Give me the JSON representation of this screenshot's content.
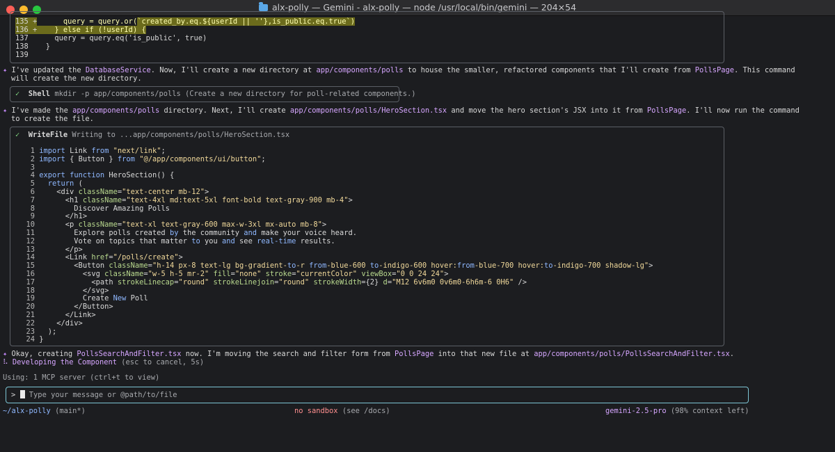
{
  "window": {
    "title": "alx-polly — Gemini - alx-polly — node /usr/local/bin/gemini — 204×54",
    "traffic_lights": [
      "#fe5f57",
      "#febc2e",
      "#28c840"
    ]
  },
  "diff_block": {
    "lines": [
      {
        "num": "135",
        "mark": "+",
        "code": "      query = query.or(`created_by.eq.${userId || ''},is_public.eq.true`)"
      },
      {
        "num": "136",
        "mark": "+",
        "code": "    } else if (!userId) {"
      },
      {
        "num": "137",
        "mark": "",
        "code": "      query = query.eq('is_public', true)"
      },
      {
        "num": "138",
        "mark": "",
        "code": "    }"
      },
      {
        "num": "139",
        "mark": "",
        "code": ""
      }
    ]
  },
  "message1": {
    "marker": "✦",
    "line1": {
      "a": "I've updated the ",
      "b": "DatabaseService",
      "c": ". Now, I'll create a new directory at ",
      "d": "app/components/polls",
      "e": " to house the smaller, refactored components that I'll create from ",
      "f": "PollsPage",
      "g": ". This command"
    },
    "line2": "will create the new directory."
  },
  "shell_tool": {
    "check": "✓",
    "name": "Shell",
    "desc": "mkdir -p app/components/polls (Create a new directory for poll-related components.)"
  },
  "message2": {
    "marker": "✦",
    "line1": {
      "a": "I've made the ",
      "b": "app/components/polls",
      "c": " directory. Next, I'll create ",
      "d": "app/components/polls/HeroSection.tsx",
      "e": " and move the hero section's JSX into it from ",
      "f": "PollsPage",
      "g": ". I'll now run the command"
    },
    "line2": "to create the file."
  },
  "writefile_tool": {
    "check": "✓",
    "name": "WriteFile",
    "desc": "Writing to ...app/components/polls/HeroSection.tsx",
    "code": [
      "import Link from \"next/link\";",
      "import { Button } from \"@/app/components/ui/button\";",
      "",
      "export function HeroSection() {",
      "  return (",
      "    <div className=\"text-center mb-12\">",
      "      <h1 className=\"text-4xl md:text-5xl font-bold text-gray-900 mb-4\">",
      "        Discover Amazing Polls",
      "      </h1>",
      "      <p className=\"text-xl text-gray-600 max-w-3xl mx-auto mb-8\">",
      "        Explore polls created by the community and make your voice heard.",
      "        Vote on topics that matter to you and see real-time results.",
      "      </p>",
      "      <Link href=\"/polls/create\">",
      "        <Button className=\"h-14 px-8 text-lg bg-gradient-to-r from-blue-600 to-indigo-600 hover:from-blue-700 hover:to-indigo-700 shadow-lg\">",
      "          <svg className=\"w-5 h-5 mr-2\" fill=\"none\" stroke=\"currentColor\" viewBox=\"0 0 24 24\">",
      "            <path strokeLinecap=\"round\" strokeLinejoin=\"round\" strokeWidth={2} d=\"M12 6v6m0 0v6m0-6h6m-6 0H6\" />",
      "          </svg>",
      "          Create New Poll",
      "        </Button>",
      "      </Link>",
      "    </div>",
      "  );",
      "}"
    ]
  },
  "message3": {
    "marker": "✦",
    "a": "Okay, creating ",
    "b": "PollsSearchAndFilter.tsx",
    "c": " now. I'm moving the search and filter form from ",
    "d": "PollsPage",
    "e": " into that new file at ",
    "f": "app/components/polls/PollsSearchAndFilter.tsx",
    "g": "."
  },
  "status_spinner": {
    "glyph": "⠧",
    "text": "Developing the Component",
    "hint": "(esc to cancel, 5s)"
  },
  "mcp_info": "Using: 1 MCP server (ctrl+t to view)",
  "input": {
    "prompt": ">",
    "placeholder": "Type your message or @path/to/file"
  },
  "footer": {
    "path": "~/alx-polly",
    "branch": "(main*)",
    "sandbox": "no sandbox",
    "sandbox_hint": "(see /docs)",
    "model": "gemini-2.5-pro",
    "context": "(98% context left)"
  }
}
